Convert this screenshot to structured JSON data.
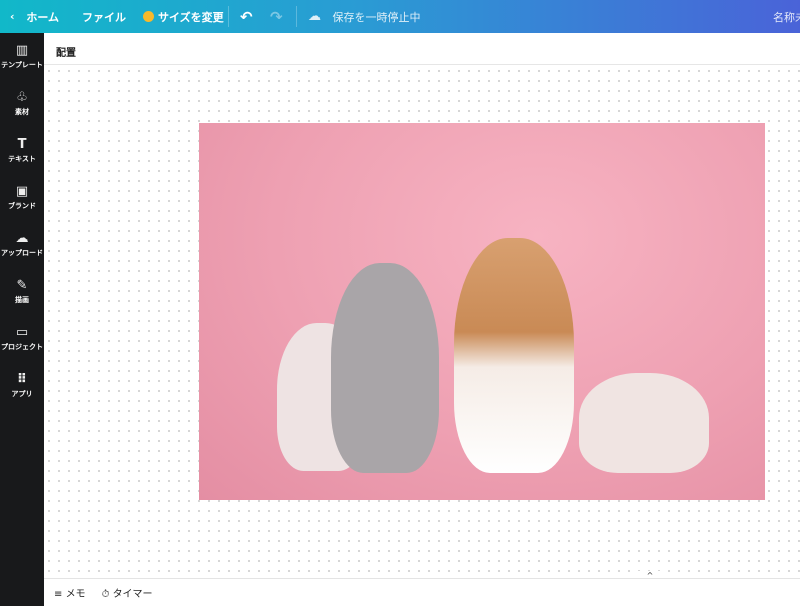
{
  "topbar": {
    "home": "ホーム",
    "file": "ファイル",
    "resize": "サイズを変更",
    "save_status": "保存を一時停止中",
    "title": "名称未"
  },
  "sidebar": {
    "items": [
      {
        "label": "テンプレート",
        "icon": "▥"
      },
      {
        "label": "素材",
        "icon": "♧"
      },
      {
        "label": "テキスト",
        "icon": "T"
      },
      {
        "label": "ブランド",
        "icon": "▣"
      },
      {
        "label": "アップロード",
        "icon": "☁"
      },
      {
        "label": "描画",
        "icon": "✎"
      },
      {
        "label": "プロジェクト",
        "icon": "▭"
      },
      {
        "label": "アプリ",
        "icon": "⠿"
      }
    ]
  },
  "subbar": {
    "label": "配置"
  },
  "bottom": {
    "memo": "メモ",
    "timer": "タイマー"
  },
  "colors": {
    "accent_start": "#11b8c9",
    "accent_end": "#4a63d8",
    "sidebar": "#18191b"
  }
}
